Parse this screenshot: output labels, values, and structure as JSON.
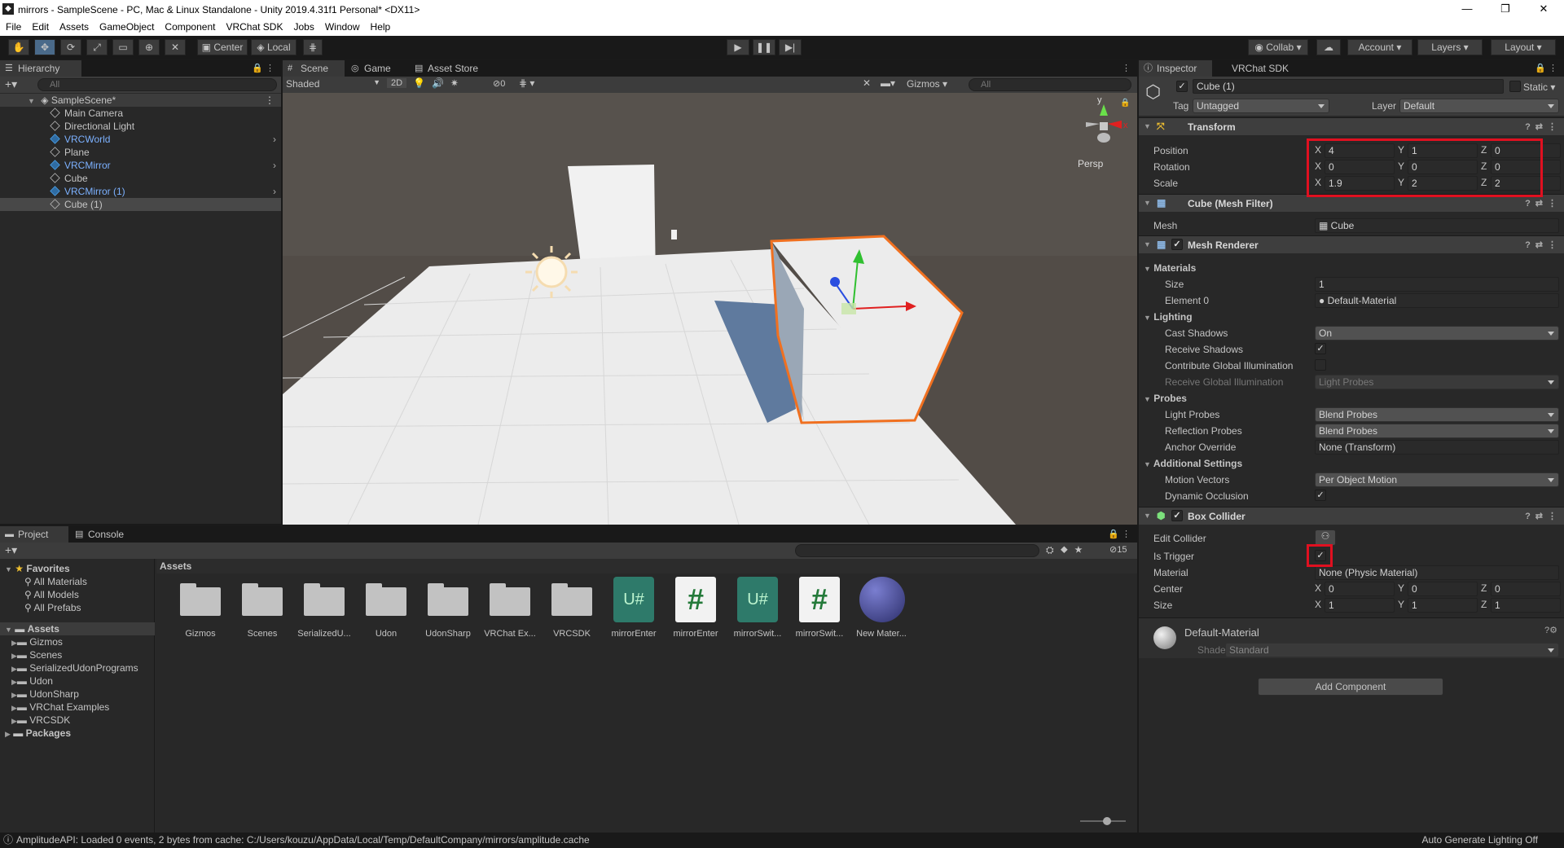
{
  "window": {
    "title": "mirrors - SampleScene - PC, Mac & Linux Standalone - Unity 2019.4.31f1 Personal* <DX11>",
    "minimize": "—",
    "restore": "❐",
    "close": "✕"
  },
  "menu": [
    "File",
    "Edit",
    "Assets",
    "GameObject",
    "Component",
    "VRChat SDK",
    "Jobs",
    "Window",
    "Help"
  ],
  "toolbar": {
    "pivot": "Center",
    "space": "Local",
    "collab": "Collab",
    "account": "Account",
    "layers": "Layers",
    "layout": "Layout"
  },
  "hierarchy": {
    "tab": "Hierarchy",
    "search_placeholder": "All",
    "scene": "SampleScene*",
    "items": [
      {
        "label": "Main Camera",
        "prefab": false
      },
      {
        "label": "Directional Light",
        "prefab": false
      },
      {
        "label": "VRCWorld",
        "prefab": true
      },
      {
        "label": "Plane",
        "prefab": false
      },
      {
        "label": "VRCMirror",
        "prefab": true
      },
      {
        "label": "Cube",
        "prefab": false
      },
      {
        "label": "VRCMirror (1)",
        "prefab": true
      },
      {
        "label": "Cube (1)",
        "prefab": false,
        "selected": true
      }
    ]
  },
  "scene": {
    "tabs": [
      "Scene",
      "Game",
      "Asset Store"
    ],
    "shading": "Shaded",
    "mode2d": "2D",
    "hidden_count": "0",
    "gizmos": "Gizmos",
    "search_placeholder": "All",
    "persp": "Persp",
    "axis_y": "y",
    "axis_x": "x"
  },
  "project": {
    "tabs": [
      "Project",
      "Console"
    ],
    "hidden_count": "15",
    "favorites": {
      "label": "Favorites",
      "items": [
        "All Materials",
        "All Models",
        "All Prefabs"
      ]
    },
    "assets_root": "Assets",
    "tree": [
      "Gizmos",
      "Scenes",
      "SerializedUdonPrograms",
      "Udon",
      "UdonSharp",
      "VRChat Examples",
      "VRCSDK"
    ],
    "packages": "Packages",
    "breadcrumb": "Assets",
    "grid": [
      {
        "label": "Gizmos",
        "kind": "folder"
      },
      {
        "label": "Scenes",
        "kind": "folder"
      },
      {
        "label": "SerializedU...",
        "kind": "folder"
      },
      {
        "label": "Udon",
        "kind": "folder"
      },
      {
        "label": "UdonSharp",
        "kind": "folder"
      },
      {
        "label": "VRChat Ex...",
        "kind": "folder"
      },
      {
        "label": "VRCSDK",
        "kind": "folder"
      },
      {
        "label": "mirrorEnter",
        "kind": "udon"
      },
      {
        "label": "mirrorEnter",
        "kind": "script"
      },
      {
        "label": "mirrorSwit...",
        "kind": "udon"
      },
      {
        "label": "mirrorSwit...",
        "kind": "script"
      },
      {
        "label": "New Mater...",
        "kind": "material"
      }
    ]
  },
  "inspector": {
    "tabs": [
      "Inspector",
      "VRChat SDK"
    ],
    "object_name": "Cube (1)",
    "static": "Static",
    "tag_label": "Tag",
    "tag": "Untagged",
    "layer_label": "Layer",
    "layer": "Default",
    "transform": {
      "title": "Transform",
      "position_label": "Position",
      "rotation_label": "Rotation",
      "scale_label": "Scale",
      "position": {
        "x": "4",
        "y": "1",
        "z": "0"
      },
      "rotation": {
        "x": "0",
        "y": "0",
        "z": "0"
      },
      "scale": {
        "x": "1.9",
        "y": "2",
        "z": "2"
      }
    },
    "mesh_filter": {
      "title": "Cube (Mesh Filter)",
      "mesh_label": "Mesh",
      "mesh": "Cube"
    },
    "mesh_renderer": {
      "title": "Mesh Renderer",
      "materials": "Materials",
      "size_label": "Size",
      "size": "1",
      "element0_label": "Element 0",
      "element0": "Default-Material",
      "lighting": "Lighting",
      "cast_shadows_label": "Cast Shadows",
      "cast_shadows": "On",
      "receive_shadows_label": "Receive Shadows",
      "contribute_gi_label": "Contribute Global Illumination",
      "receive_gi_label": "Receive Global Illumination",
      "receive_gi": "Light Probes",
      "probes": "Probes",
      "light_probes_label": "Light Probes",
      "light_probes": "Blend Probes",
      "reflection_probes_label": "Reflection Probes",
      "reflection_probes": "Blend Probes",
      "anchor_label": "Anchor Override",
      "anchor": "None (Transform)",
      "additional": "Additional Settings",
      "motion_vectors_label": "Motion Vectors",
      "motion_vectors": "Per Object Motion",
      "dynamic_occlusion_label": "Dynamic Occlusion"
    },
    "box_collider": {
      "title": "Box Collider",
      "edit_label": "Edit Collider",
      "is_trigger_label": "Is Trigger",
      "material_label": "Material",
      "material": "None (Physic Material)",
      "center_label": "Center",
      "center": {
        "x": "0",
        "y": "0",
        "z": "0"
      },
      "size_label": "Size",
      "size": {
        "x": "1",
        "y": "1",
        "z": "1"
      }
    },
    "material": {
      "name": "Default-Material",
      "shader_label": "Shader",
      "shader": "Standard"
    },
    "add_component": "Add Component"
  },
  "status": {
    "message": "AmplitudeAPI: Loaded 0 events, 2 bytes from cache: C:/Users/kouzu/AppData/Local/Temp/DefaultCompany/mirrors/amplitude.cache",
    "lighting": "Auto Generate Lighting Off"
  },
  "colors": {
    "highlight": "#e01020",
    "selection_outline": "#f07020",
    "prefab_blue": "#7cb1ff"
  }
}
